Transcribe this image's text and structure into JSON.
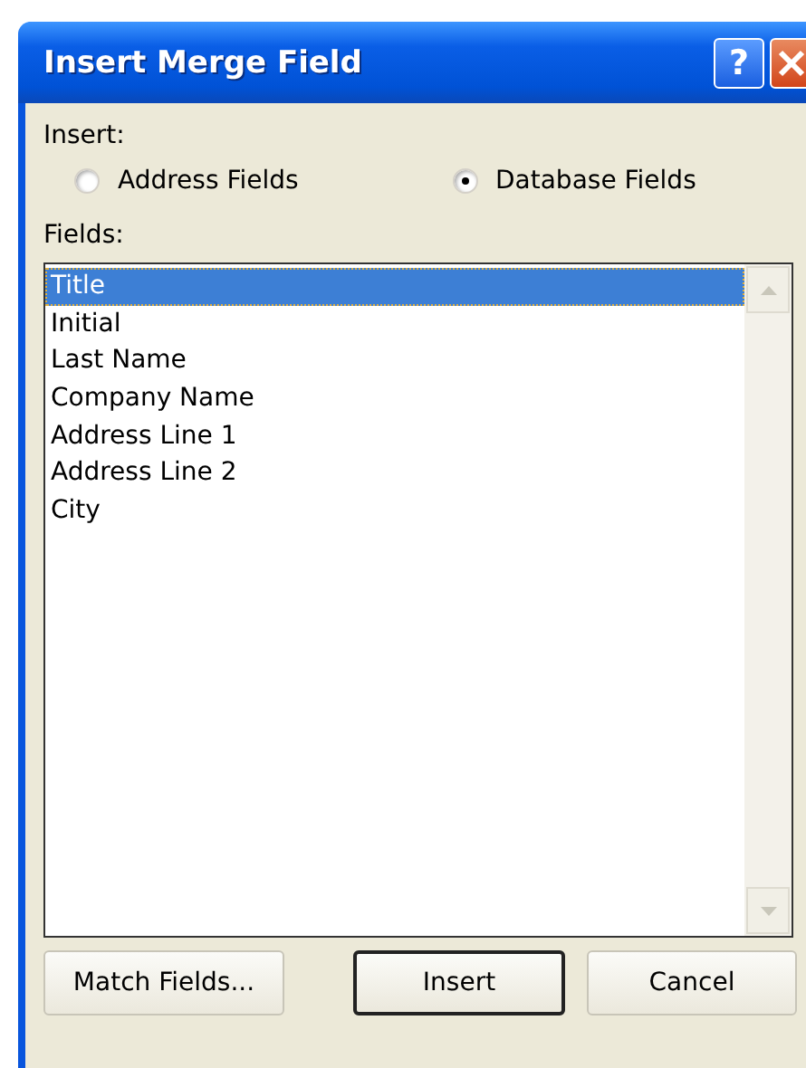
{
  "window": {
    "title": "Insert Merge Field",
    "title_buttons": [
      {
        "kind": "help",
        "label": "?"
      },
      {
        "kind": "close"
      }
    ]
  },
  "insert": {
    "label": "Insert:",
    "options": [
      {
        "label": "Address Fields",
        "selected": false
      },
      {
        "label": "Database Fields",
        "selected": true
      }
    ]
  },
  "fields": {
    "label": "Fields:",
    "items": [
      {
        "label": "Title",
        "selected": true
      },
      {
        "label": "Initial",
        "selected": false
      },
      {
        "label": "Last Name",
        "selected": false
      },
      {
        "label": "Company Name",
        "selected": false
      },
      {
        "label": "Address Line 1",
        "selected": false
      },
      {
        "label": "Address Line 2",
        "selected": false
      },
      {
        "label": "City",
        "selected": false
      }
    ]
  },
  "buttons": [
    {
      "label": "Match Fields...",
      "default": false
    },
    {
      "label": "Insert",
      "default": true
    },
    {
      "label": "Cancel",
      "default": false
    }
  ]
}
